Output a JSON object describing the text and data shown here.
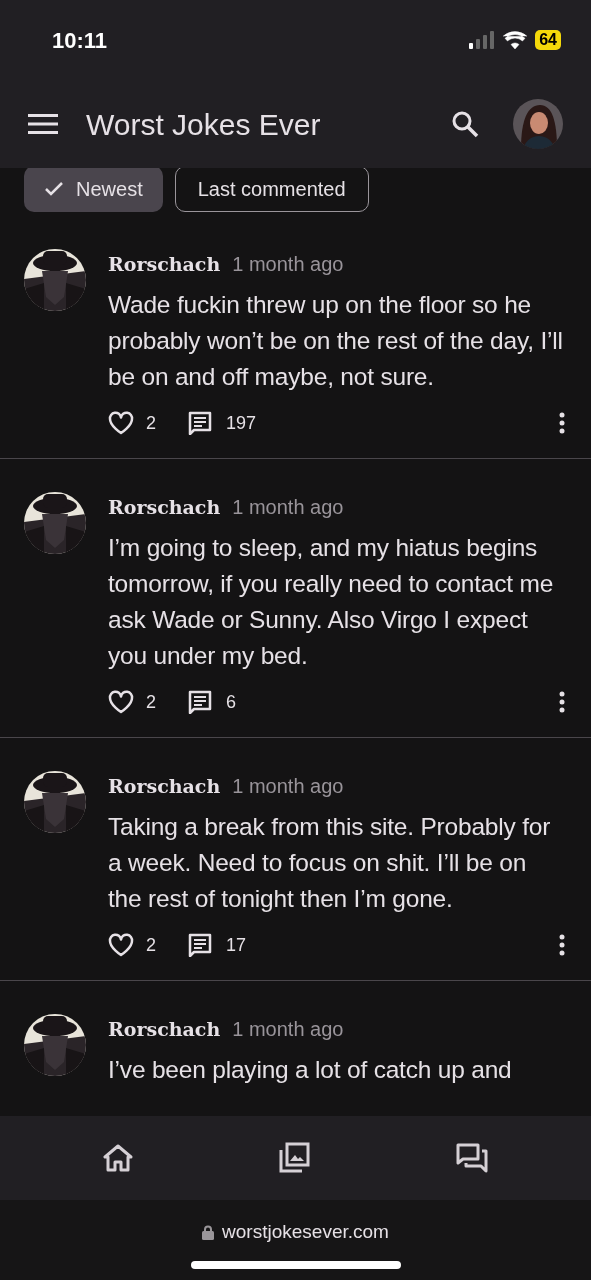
{
  "status_bar": {
    "time": "10:11",
    "battery": "64"
  },
  "app_bar": {
    "title": "Worst Jokes Ever"
  },
  "filters": [
    {
      "label": "Newest",
      "selected": true
    },
    {
      "label": "Last commented",
      "selected": false
    }
  ],
  "posts": [
    {
      "author": "Rorschach",
      "time": "1 month ago",
      "text": "Wade fuckin threw up on the floor so he probably won’t be on the rest of the day, I’ll be on and off maybe, not sure.",
      "likes": "2",
      "comments": "197"
    },
    {
      "author": "Rorschach",
      "time": "1 month ago",
      "text": "I’m going to sleep, and my hiatus begins tomorrow, if you really need to contact me ask Wade or Sunny. Also Virgo I expect you under my bed.",
      "likes": "2",
      "comments": "6"
    },
    {
      "author": "Rorschach",
      "time": "1 month ago",
      "text": "Taking a break from this site. Probably for a week. Need to focus on shit. I’ll be on the rest of tonight then I’m gone.",
      "likes": "2",
      "comments": "17"
    },
    {
      "author": "Rorschach",
      "time": "1 month ago",
      "text": "I’ve been playing a lot of catch up and"
    }
  ],
  "browser": {
    "url": "worstjokesever.com"
  }
}
